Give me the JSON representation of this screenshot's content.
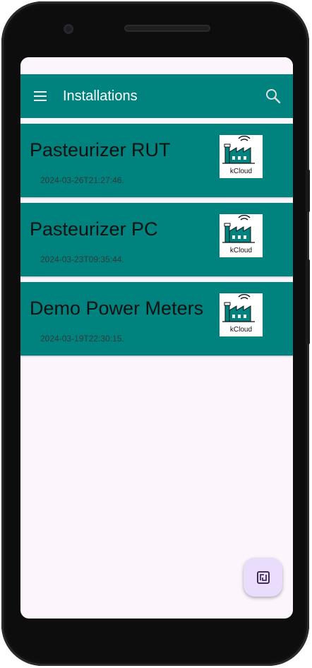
{
  "app_bar": {
    "title": "Installations",
    "menu_icon": "hamburger-menu-icon",
    "search_icon": "search-icon",
    "color": "#00827f"
  },
  "installations": [
    {
      "name": "Pasteurizer RUT",
      "date": "2024-03-26T21:27:46.",
      "logo_text": "kCloud"
    },
    {
      "name": "Pasteurizer PC",
      "date": "2024-03-23T09:35:44.",
      "logo_text": "kCloud"
    },
    {
      "name": "Demo Power Meters",
      "date": "2024-03-19T22:30:15.",
      "logo_text": "kCloud"
    }
  ],
  "fab": {
    "icon": "nfc-icon",
    "color": "#eadcfb"
  },
  "colors": {
    "accent": "#00827f",
    "background": "#fcf5fc"
  }
}
